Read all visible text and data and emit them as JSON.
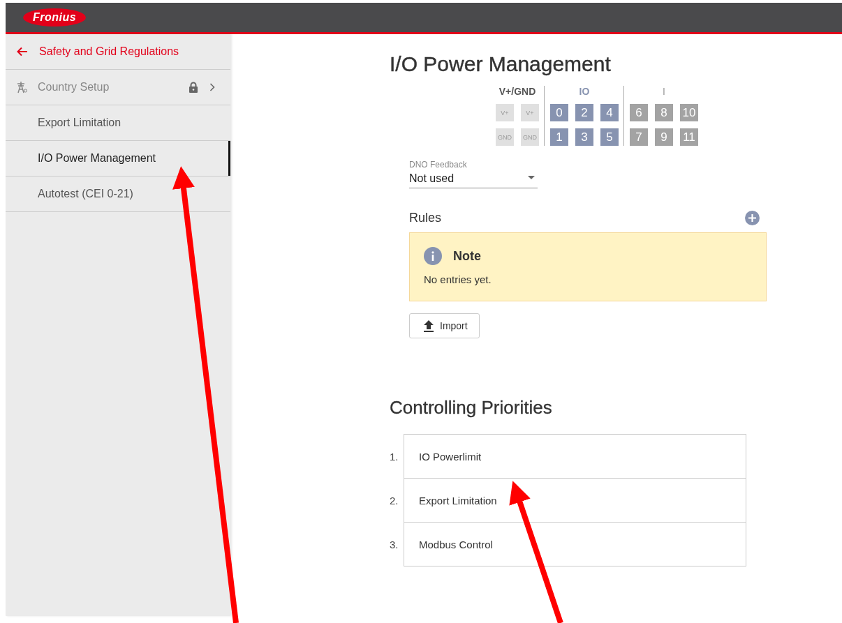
{
  "header": {
    "logo": "Fronius"
  },
  "sidebar": {
    "back": {
      "label": "Safety and Grid Regulations"
    },
    "items": [
      {
        "label": "Country Setup",
        "kind": "submenu",
        "locked": true,
        "selected": false
      },
      {
        "label": "Export Limitation",
        "kind": "page",
        "locked": false,
        "selected": false
      },
      {
        "label": "I/O Power Management",
        "kind": "page",
        "locked": false,
        "selected": true
      },
      {
        "label": "Autotest (CEI 0-21)",
        "kind": "page",
        "locked": false,
        "selected": false
      }
    ]
  },
  "page_title": "I/O Power Management",
  "connectors": [
    {
      "label": "V+/GND",
      "kind": "power",
      "rows": [
        [
          "V+",
          "V+"
        ],
        [
          "GND",
          "GND"
        ]
      ]
    },
    {
      "label": "IO",
      "kind": "io",
      "rows": [
        [
          "0",
          "2",
          "4"
        ],
        [
          "1",
          "3",
          "5"
        ]
      ]
    },
    {
      "label": "I",
      "kind": "input",
      "rows": [
        [
          "6",
          "8",
          "10"
        ],
        [
          "7",
          "9",
          "11"
        ]
      ]
    }
  ],
  "dno_feedback": {
    "label": "DNO Feedback",
    "value": "Not used"
  },
  "rules": {
    "title": "Rules",
    "note": {
      "title": "Note",
      "text": "No entries yet."
    },
    "import_button": "Import"
  },
  "priorities": {
    "title": "Controlling Priorities",
    "items": [
      {
        "number": "1.",
        "label": "IO Powerlimit"
      },
      {
        "number": "2.",
        "label": "Export Limitation"
      },
      {
        "number": "3.",
        "label": "Modbus Control"
      }
    ]
  }
}
